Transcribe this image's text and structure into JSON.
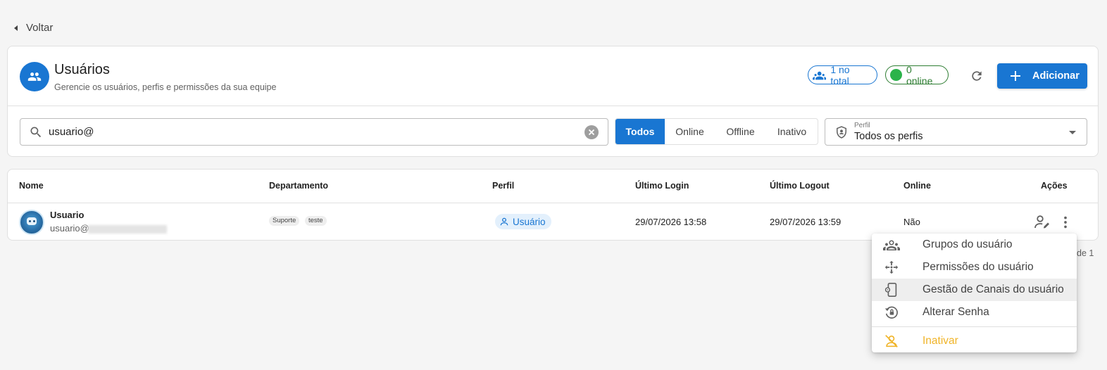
{
  "nav": {
    "back_label": "Voltar"
  },
  "header": {
    "title": "Usuários",
    "subtitle": "Gerencie os usuários, perfis e permissões da sua equipe",
    "total_chip": "1 no total",
    "online_chip": "0 online",
    "add_label": "Adicionar"
  },
  "filters": {
    "search_value": "usuario@",
    "status_options": [
      "Todos",
      "Online",
      "Offline",
      "Inativo"
    ],
    "status_selected": "Todos",
    "profile_label": "Perfil",
    "profile_value": "Todos os perfis"
  },
  "table": {
    "headers": [
      "Nome",
      "Departamento",
      "Perfil",
      "Último Login",
      "Último Logout",
      "Online",
      "Ações"
    ],
    "rows": [
      {
        "name": "Usuario",
        "email_prefix": "usuario@",
        "departments": [
          "Suporte",
          "teste"
        ],
        "profile": "Usuário",
        "last_login": "29/07/2026 13:58",
        "last_logout": "29/07/2026 13:59",
        "online": "Não"
      }
    ]
  },
  "pagination": {
    "text": "de 1"
  },
  "context_menu": {
    "items": [
      {
        "label": "Grupos do usuário",
        "icon": "groups-icon"
      },
      {
        "label": "Permissões do usuário",
        "icon": "move-arrows-icon"
      },
      {
        "label": "Gestão de Canais do usuário",
        "icon": "phone-settings-icon"
      },
      {
        "label": "Alterar Senha",
        "icon": "lock-reset-icon"
      },
      {
        "label": "Inativar",
        "icon": "person-off-icon"
      }
    ]
  },
  "colors": {
    "primary": "#1976d2",
    "online_green": "#2e7d32",
    "warning": "#f0b429"
  }
}
